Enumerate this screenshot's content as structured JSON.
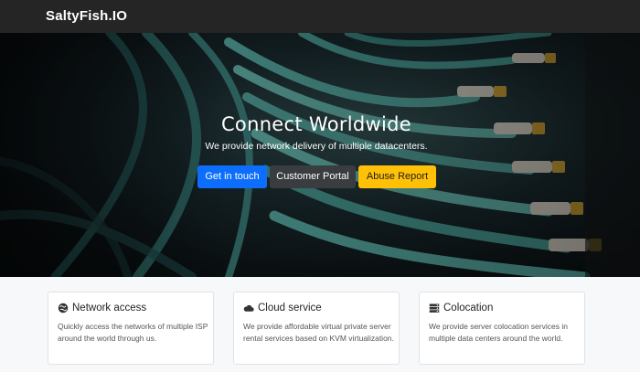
{
  "navbar": {
    "brand": "SaltyFish.IO"
  },
  "hero": {
    "title": "Connect Worldwide",
    "subtitle": "We provide network delivery of multiple datacenters.",
    "buttons": {
      "get_in_touch": "Get in touch",
      "customer_portal": "Customer Portal",
      "abuse_report": "Abuse Report"
    }
  },
  "features": [
    {
      "icon": "globe-icon",
      "title": "Network access",
      "text": "Quickly access the networks of multiple ISP around the world through us."
    },
    {
      "icon": "cloud-icon",
      "title": "Cloud service",
      "text": "We provide affordable virtual private server rental services based on KVM virtualization."
    },
    {
      "icon": "server-icon",
      "title": "Colocation",
      "text": "We provide server colocation services in multiple data centers around the world."
    }
  ],
  "colors": {
    "primary": "#0d6efd",
    "dark": "#3a3d40",
    "warning": "#ffc107",
    "navbar": "#252525"
  }
}
